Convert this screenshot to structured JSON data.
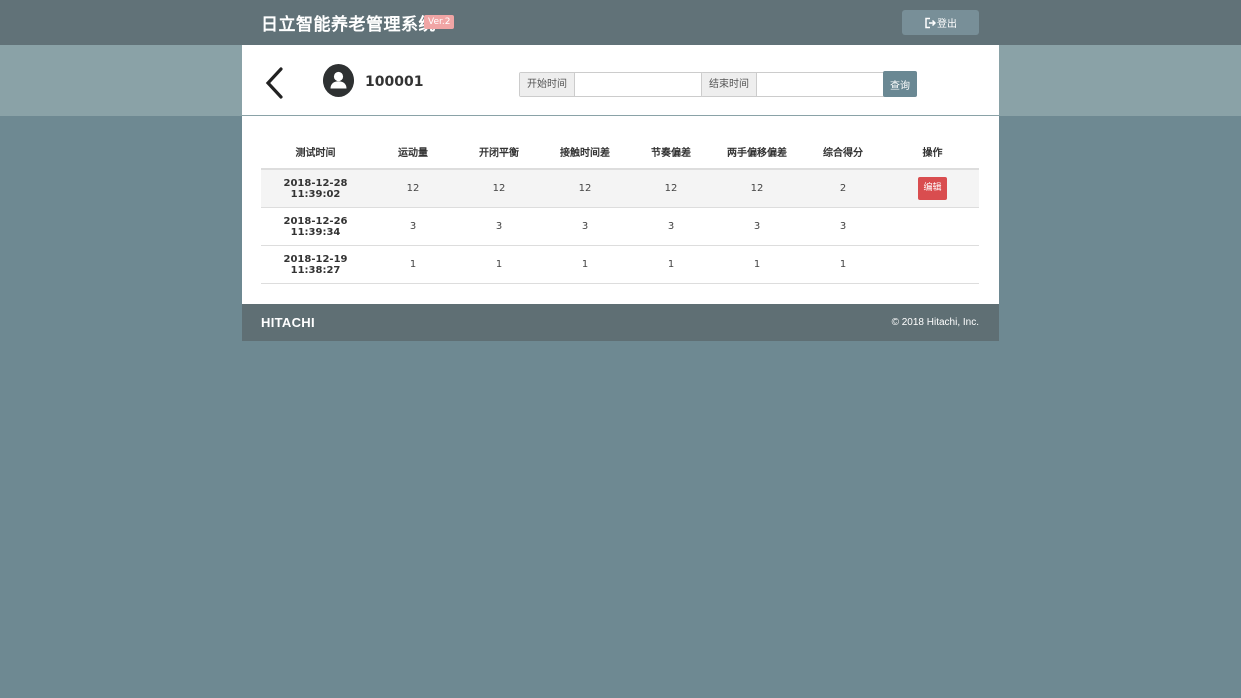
{
  "app": {
    "title": "日立智能养老管理系统",
    "version_badge": "Ver.2"
  },
  "header": {
    "logout_label": "登出"
  },
  "user": {
    "id": "100001"
  },
  "search": {
    "start_label": "开始时间",
    "start_value": "",
    "end_label": "结束时间",
    "end_value": "",
    "query_label": "查询"
  },
  "table": {
    "columns": [
      "测试时间",
      "运动量",
      "开闭平衡",
      "接触时间差",
      "节奏偏差",
      "两手偏移偏差",
      "综合得分",
      "操作"
    ],
    "rows": [
      {
        "time": "2018-12-28 11:39:02",
        "v1": "12",
        "v2": "12",
        "v3": "12",
        "v4": "12",
        "v5": "12",
        "score": "2",
        "action": "编辑"
      },
      {
        "time": "2018-12-26 11:39:34",
        "v1": "3",
        "v2": "3",
        "v3": "3",
        "v4": "3",
        "v5": "3",
        "score": "3",
        "action": ""
      },
      {
        "time": "2018-12-19 11:38:27",
        "v1": "1",
        "v2": "1",
        "v3": "1",
        "v4": "1",
        "v5": "1",
        "score": "1",
        "action": ""
      }
    ]
  },
  "footer": {
    "logo": "HITACHI",
    "copyright": "© 2018 Hitachi, Inc."
  },
  "colors": {
    "accent": "#6a8893",
    "danger": "#d94d4f",
    "topbar": "#617278",
    "background": "#6e8992"
  }
}
